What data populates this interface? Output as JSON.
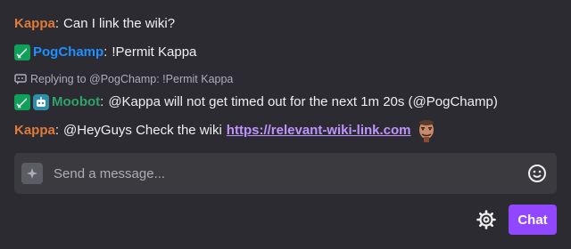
{
  "messages": [
    {
      "user": "Kappa",
      "user_color": "#e07b39",
      "text": "Can I link the wiki?"
    },
    {
      "user": "PogChamp",
      "user_color": "#1e90ff",
      "badges": [
        "sword-badge-icon"
      ],
      "text": "!Permit Kappa"
    },
    {
      "reply_context": "Replying to @PogChamp: !Permit Kappa",
      "user": "Moobot",
      "user_color": "#2fa36b",
      "badges": [
        "sword-badge-icon",
        "robot-badge-icon"
      ],
      "text": "@Kappa will not get timed out for the next 1m 20s (@PogChamp)"
    },
    {
      "user": "Kappa",
      "user_color": "#e07b39",
      "text_prefix": "@HeyGuys Check the wiki",
      "link": "https://relevant-wiki-link.com",
      "emote": "kappa-emote"
    }
  ],
  "separator": ":",
  "input": {
    "placeholder": "Send a message..."
  },
  "chat_button": "Chat",
  "colors": {
    "background": "#2b2b31",
    "accent": "#9147ff",
    "link": "#bf94ff"
  }
}
